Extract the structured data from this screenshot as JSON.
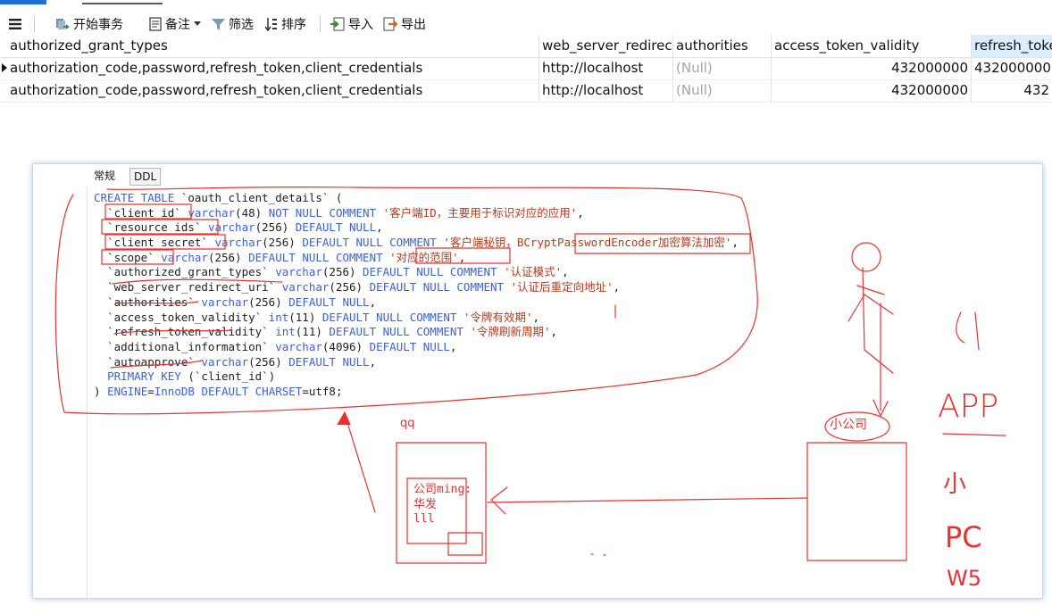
{
  "toolbar": {
    "menu_icon": "hamburger-icon",
    "buttons": [
      {
        "label": "开始事务",
        "icon": "transaction-icon"
      },
      {
        "label": "备注",
        "icon": "note-icon"
      },
      {
        "label": "筛选",
        "icon": "filter-icon"
      },
      {
        "label": "排序",
        "icon": "sort-icon"
      },
      {
        "label": "导入",
        "icon": "import-icon"
      },
      {
        "label": "导出",
        "icon": "export-icon"
      }
    ]
  },
  "grid": {
    "columns": [
      "authorized_grant_types",
      "web_server_redirect",
      "authorities",
      "access_token_validity",
      "refresh_toke"
    ],
    "rows": [
      [
        "authorization_code,password,refresh_token,client_credentials",
        "http://localhost",
        "(Null)",
        "432000000",
        "432000000"
      ],
      [
        "authorization_code,password,refresh_token,client_credentials",
        "http://localhost",
        "(Null)",
        "432000000",
        "432"
      ]
    ]
  },
  "panel": {
    "tabs": [
      "常规",
      "DDL"
    ],
    "active_tab": "DDL"
  },
  "ddl": {
    "lines": [
      [
        {
          "t": "CREATE TABLE",
          "c": "kw"
        },
        {
          "t": " `oauth_client_details` (",
          "c": ""
        }
      ],
      [
        {
          "t": "  `client_id` ",
          "c": ""
        },
        {
          "t": "varchar",
          "c": "kw"
        },
        {
          "t": "(48) ",
          "c": ""
        },
        {
          "t": "NOT NULL COMMENT",
          "c": "kw"
        },
        {
          "t": " ",
          "c": ""
        },
        {
          "t": "'客户端ID，主要用于标识对应的应用'",
          "c": "str"
        },
        {
          "t": ",",
          "c": ""
        }
      ],
      [
        {
          "t": "  `resource_ids` ",
          "c": ""
        },
        {
          "t": "varchar",
          "c": "kw"
        },
        {
          "t": "(256) ",
          "c": ""
        },
        {
          "t": "DEFAULT NULL",
          "c": "kw"
        },
        {
          "t": ",",
          "c": ""
        }
      ],
      [
        {
          "t": "  `client_secret` ",
          "c": ""
        },
        {
          "t": "varchar",
          "c": "kw"
        },
        {
          "t": "(256) ",
          "c": ""
        },
        {
          "t": "DEFAULT NULL COMMENT",
          "c": "kw"
        },
        {
          "t": " ",
          "c": ""
        },
        {
          "t": "'客户端秘钥，BCryptPasswordEncoder加密算法加密'",
          "c": "str"
        },
        {
          "t": ",",
          "c": ""
        }
      ],
      [
        {
          "t": "  `scope` ",
          "c": ""
        },
        {
          "t": "varchar",
          "c": "kw"
        },
        {
          "t": "(256) ",
          "c": ""
        },
        {
          "t": "DEFAULT NULL COMMENT",
          "c": "kw"
        },
        {
          "t": " ",
          "c": ""
        },
        {
          "t": "'对应的范围'",
          "c": "str"
        },
        {
          "t": ",",
          "c": ""
        }
      ],
      [
        {
          "t": "  `authorized_grant_types` ",
          "c": ""
        },
        {
          "t": "varchar",
          "c": "kw"
        },
        {
          "t": "(256) ",
          "c": ""
        },
        {
          "t": "DEFAULT NULL COMMENT",
          "c": "kw"
        },
        {
          "t": " ",
          "c": ""
        },
        {
          "t": "'认证模式'",
          "c": "str"
        },
        {
          "t": ",",
          "c": ""
        }
      ],
      [
        {
          "t": "  `web_server_redirect_uri` ",
          "c": ""
        },
        {
          "t": "varchar",
          "c": "kw"
        },
        {
          "t": "(256) ",
          "c": ""
        },
        {
          "t": "DEFAULT NULL COMMENT",
          "c": "kw"
        },
        {
          "t": " ",
          "c": ""
        },
        {
          "t": "'认证后重定向地址'",
          "c": "str"
        },
        {
          "t": ",",
          "c": ""
        }
      ],
      [
        {
          "t": "  `authorities` ",
          "c": ""
        },
        {
          "t": "varchar",
          "c": "kw"
        },
        {
          "t": "(256) ",
          "c": ""
        },
        {
          "t": "DEFAULT NULL",
          "c": "kw"
        },
        {
          "t": ",",
          "c": ""
        }
      ],
      [
        {
          "t": "  `access_token_validity` ",
          "c": ""
        },
        {
          "t": "int",
          "c": "kw"
        },
        {
          "t": "(11) ",
          "c": ""
        },
        {
          "t": "DEFAULT NULL COMMENT",
          "c": "kw"
        },
        {
          "t": " ",
          "c": ""
        },
        {
          "t": "'令牌有效期'",
          "c": "str"
        },
        {
          "t": ",",
          "c": ""
        }
      ],
      [
        {
          "t": "  `refresh_token_validity` ",
          "c": ""
        },
        {
          "t": "int",
          "c": "kw"
        },
        {
          "t": "(11) ",
          "c": ""
        },
        {
          "t": "DEFAULT NULL COMMENT",
          "c": "kw"
        },
        {
          "t": " ",
          "c": ""
        },
        {
          "t": "'令牌刷新周期'",
          "c": "str"
        },
        {
          "t": ",",
          "c": ""
        }
      ],
      [
        {
          "t": "  `additional_information` ",
          "c": ""
        },
        {
          "t": "varchar",
          "c": "kw"
        },
        {
          "t": "(4096) ",
          "c": ""
        },
        {
          "t": "DEFAULT NULL",
          "c": "kw"
        },
        {
          "t": ",",
          "c": ""
        }
      ],
      [
        {
          "t": "  `autoapprove` ",
          "c": ""
        },
        {
          "t": "varchar",
          "c": "kw"
        },
        {
          "t": "(256) ",
          "c": ""
        },
        {
          "t": "DEFAULT NULL",
          "c": "kw"
        },
        {
          "t": ",",
          "c": ""
        }
      ],
      [
        {
          "t": "  ",
          "c": ""
        },
        {
          "t": "PRIMARY KEY",
          "c": "kw"
        },
        {
          "t": " (`client_id`)",
          "c": ""
        }
      ],
      [
        {
          "t": ") ",
          "c": ""
        },
        {
          "t": "ENGINE",
          "c": "kw"
        },
        {
          "t": "=",
          "c": ""
        },
        {
          "t": "InnoDB",
          "c": "kw"
        },
        {
          "t": " ",
          "c": ""
        },
        {
          "t": "DEFAULT CHARSET",
          "c": "kw"
        },
        {
          "t": "=utf8;",
          "c": ""
        }
      ]
    ]
  },
  "annotations": {
    "qq": "qq",
    "company_box": [
      "公司ming:",
      "华发",
      "lll"
    ],
    "small_company": "小公司",
    "side_notes": [
      "APP",
      "小",
      "PC",
      "W5"
    ],
    "color": "#e53232"
  }
}
